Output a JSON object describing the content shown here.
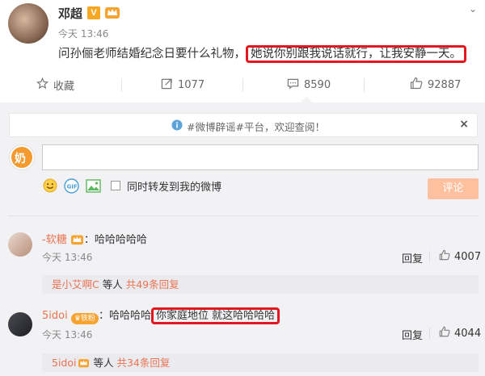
{
  "post": {
    "author": "邓超",
    "v_badge": "V",
    "time": "今天 13:46",
    "text_plain": "问孙俪老师结婚纪念日要什么礼物，",
    "text_highlight": "她说你别跟我说话就行，让我安静一天。"
  },
  "actions": {
    "favorite": "收藏",
    "repost": "1077",
    "comment": "8590",
    "like": "92887"
  },
  "notice": {
    "text": "#微博辟谣#平台，欢迎查阅！",
    "close": "×"
  },
  "composer": {
    "input_value": "",
    "also_repost": "同时转发到我的微博",
    "submit": "评论"
  },
  "comments": [
    {
      "name": "-软糖",
      "separator": "：",
      "text": "哈哈哈哈哈",
      "time": "今天 13:46",
      "reply": "回复",
      "likes": "4007",
      "sub_name": "是小艾啊C",
      "sub_mid": " 等人 ",
      "sub_count": "共49条回复"
    },
    {
      "name": "5idoi",
      "badge": "铁粉",
      "separator": "：",
      "text_plain": "哈哈哈哈",
      "text_highlight": "你家庭地位 就这哈哈哈哈",
      "time": "今天 13:46",
      "reply": "回复",
      "likes": "4044",
      "sub_name": "5idoi",
      "sub_mid": " 等人 ",
      "sub_count": "共34条回复"
    }
  ],
  "colors": {
    "accent": "#eb7350",
    "highlight_border": "#e5171e",
    "submit_bg": "#ffc09f",
    "vip_badge": "#f5a623"
  }
}
